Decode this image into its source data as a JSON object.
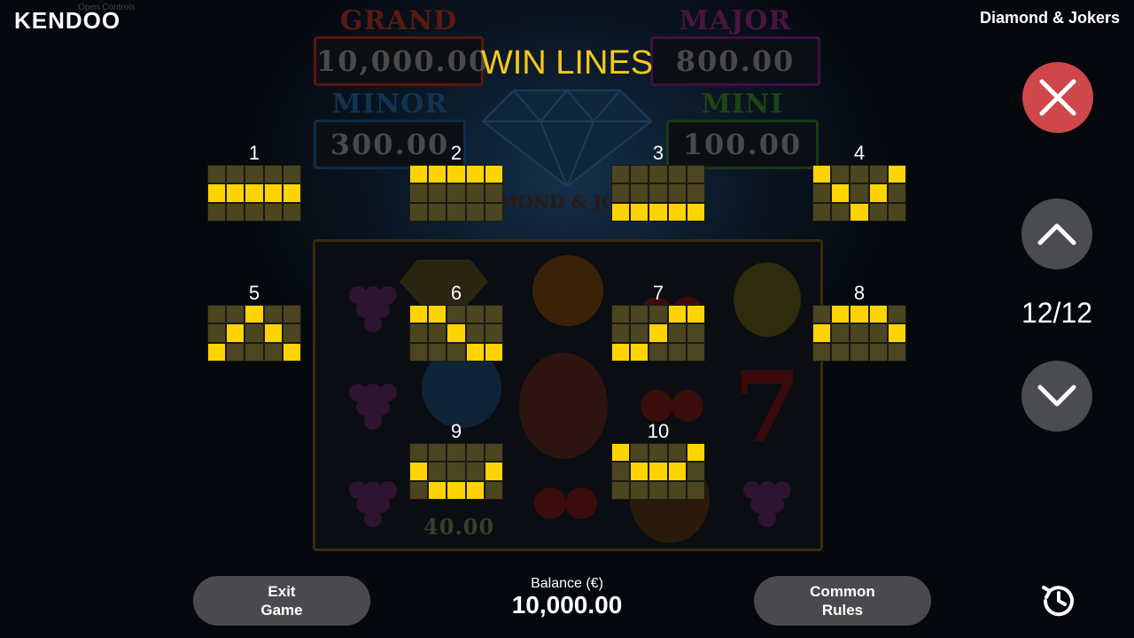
{
  "brand": {
    "logo_text": "KENDOO",
    "open_controls": "Open Controls"
  },
  "game_title": "Diamond & Jokers",
  "jackpots": [
    {
      "name": "GRAND",
      "value": "10,000.00"
    },
    {
      "name": "MAJOR",
      "value": "800.00"
    },
    {
      "name": "MINOR",
      "value": "300.00"
    },
    {
      "name": "MINI",
      "value": "100.00"
    }
  ],
  "background_logo": "DIAMOND & JOKERS",
  "reel_amount": "40.00",
  "win_lines": {
    "heading": "WIN LINES",
    "lines": [
      {
        "number": "1",
        "rows": [
          [
            0,
            0,
            0,
            0,
            0
          ],
          [
            1,
            1,
            1,
            1,
            1
          ],
          [
            0,
            0,
            0,
            0,
            0
          ]
        ]
      },
      {
        "number": "2",
        "rows": [
          [
            1,
            1,
            1,
            1,
            1
          ],
          [
            0,
            0,
            0,
            0,
            0
          ],
          [
            0,
            0,
            0,
            0,
            0
          ]
        ]
      },
      {
        "number": "3",
        "rows": [
          [
            0,
            0,
            0,
            0,
            0
          ],
          [
            0,
            0,
            0,
            0,
            0
          ],
          [
            1,
            1,
            1,
            1,
            1
          ]
        ]
      },
      {
        "number": "4",
        "rows": [
          [
            1,
            0,
            0,
            0,
            1
          ],
          [
            0,
            1,
            0,
            1,
            0
          ],
          [
            0,
            0,
            1,
            0,
            0
          ]
        ]
      },
      {
        "number": "5",
        "rows": [
          [
            0,
            0,
            1,
            0,
            0
          ],
          [
            0,
            1,
            0,
            1,
            0
          ],
          [
            1,
            0,
            0,
            0,
            1
          ]
        ]
      },
      {
        "number": "6",
        "rows": [
          [
            1,
            1,
            0,
            0,
            0
          ],
          [
            0,
            0,
            1,
            0,
            0
          ],
          [
            0,
            0,
            0,
            1,
            1
          ]
        ]
      },
      {
        "number": "7",
        "rows": [
          [
            0,
            0,
            0,
            1,
            1
          ],
          [
            0,
            0,
            1,
            0,
            0
          ],
          [
            1,
            1,
            0,
            0,
            0
          ]
        ]
      },
      {
        "number": "8",
        "rows": [
          [
            0,
            1,
            1,
            1,
            0
          ],
          [
            1,
            0,
            0,
            0,
            1
          ],
          [
            0,
            0,
            0,
            0,
            0
          ]
        ]
      },
      {
        "number": "9",
        "rows": [
          [
            0,
            0,
            0,
            0,
            0
          ],
          [
            1,
            0,
            0,
            0,
            1
          ],
          [
            0,
            1,
            1,
            1,
            0
          ]
        ]
      },
      {
        "number": "10",
        "rows": [
          [
            1,
            0,
            0,
            0,
            1
          ],
          [
            0,
            1,
            1,
            1,
            0
          ],
          [
            0,
            0,
            0,
            0,
            0
          ]
        ]
      }
    ]
  },
  "pagination": {
    "text": "12/12"
  },
  "bottom_bar": {
    "exit_label_line1": "Exit",
    "exit_label_line2": "Game",
    "balance_label": "Balance (€)",
    "balance_value": "10,000.00",
    "rules_label_line1": "Common",
    "rules_label_line2": "Rules"
  },
  "colors": {
    "accent": "#fed400",
    "close": "#cf474b",
    "button": "#4a4c50",
    "cell_off": "#4b4520"
  },
  "icons": [
    "close-icon",
    "chevron-up-icon",
    "chevron-down-icon",
    "history-icon"
  ]
}
